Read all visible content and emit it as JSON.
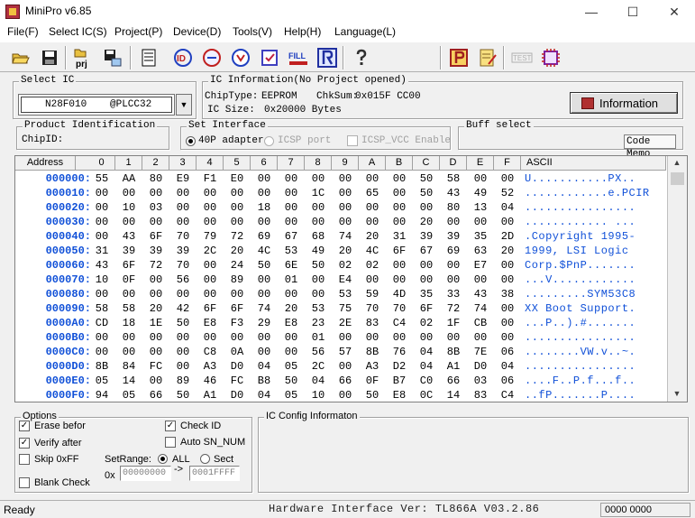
{
  "window": {
    "title": "MiniPro v6.85",
    "minimize": "—",
    "maximize": "☐",
    "close": "✕"
  },
  "menu": [
    "File(F)",
    "Select IC(S)",
    "Project(P)",
    "Device(D)",
    "Tools(V)",
    "Help(H)",
    "Language(L)"
  ],
  "toolbar": {
    "prj_label": "prj",
    "id_label": "ID",
    "fill_label": "FILL",
    "test_label": "TEST"
  },
  "select_ic": {
    "title": "Select IC",
    "name": "N28F010",
    "package": "@PLCC32"
  },
  "ic_info": {
    "title": "IC Information(No Project opened)",
    "chiptype_label": "ChipType:",
    "chiptype": "EEPROM",
    "chksum_label": "ChkSum:",
    "chksum": "0x015F CC00",
    "icsize_label": "IC Size:",
    "icsize": "0x20000 Bytes",
    "button": "Information"
  },
  "product": {
    "title": "Product Identification",
    "chipid_label": "ChipID:"
  },
  "interface": {
    "title": "Set Interface",
    "opt1": "40P adapter",
    "opt2": "ICSP port",
    "opt3": "ICSP_VCC Enable"
  },
  "buff": {
    "title": "Buff select",
    "code_memo": "Code Memo"
  },
  "hex": {
    "headers": [
      "Address",
      "0",
      "1",
      "2",
      "3",
      "4",
      "5",
      "6",
      "7",
      "8",
      "9",
      "A",
      "B",
      "C",
      "D",
      "E",
      "F",
      "ASCII"
    ],
    "rows": [
      {
        "addr": "000000:",
        "bytes": [
          "55",
          "AA",
          "80",
          "E9",
          "F1",
          "E0",
          "00",
          "00",
          "00",
          "00",
          "00",
          "00",
          "50",
          "58",
          "00",
          "00"
        ],
        "ascii": "U...........PX.."
      },
      {
        "addr": "000010:",
        "bytes": [
          "00",
          "00",
          "00",
          "00",
          "00",
          "00",
          "00",
          "00",
          "1C",
          "00",
          "65",
          "00",
          "50",
          "43",
          "49",
          "52"
        ],
        "ascii": "............e.PCIR"
      },
      {
        "addr": "000020:",
        "bytes": [
          "00",
          "10",
          "03",
          "00",
          "00",
          "00",
          "18",
          "00",
          "00",
          "00",
          "00",
          "00",
          "00",
          "80",
          "13",
          "04"
        ],
        "ascii": "................"
      },
      {
        "addr": "000030:",
        "bytes": [
          "00",
          "00",
          "00",
          "00",
          "00",
          "00",
          "00",
          "00",
          "00",
          "00",
          "00",
          "00",
          "20",
          "00",
          "00",
          "00"
        ],
        "ascii": "............ ..."
      },
      {
        "addr": "000040:",
        "bytes": [
          "00",
          "43",
          "6F",
          "70",
          "79",
          "72",
          "69",
          "67",
          "68",
          "74",
          "20",
          "31",
          "39",
          "39",
          "35",
          "2D"
        ],
        "ascii": ".Copyright 1995-"
      },
      {
        "addr": "000050:",
        "bytes": [
          "31",
          "39",
          "39",
          "39",
          "2C",
          "20",
          "4C",
          "53",
          "49",
          "20",
          "4C",
          "6F",
          "67",
          "69",
          "63",
          "20"
        ],
        "ascii": "1999, LSI Logic "
      },
      {
        "addr": "000060:",
        "bytes": [
          "43",
          "6F",
          "72",
          "70",
          "00",
          "24",
          "50",
          "6E",
          "50",
          "02",
          "02",
          "00",
          "00",
          "00",
          "E7",
          "00"
        ],
        "ascii": "Corp.$PnP......."
      },
      {
        "addr": "000070:",
        "bytes": [
          "10",
          "0F",
          "00",
          "56",
          "00",
          "89",
          "00",
          "01",
          "00",
          "E4",
          "00",
          "00",
          "00",
          "00",
          "00",
          "00"
        ],
        "ascii": "...V............"
      },
      {
        "addr": "000080:",
        "bytes": [
          "00",
          "00",
          "00",
          "00",
          "00",
          "00",
          "00",
          "00",
          "00",
          "53",
          "59",
          "4D",
          "35",
          "33",
          "43",
          "38"
        ],
        "ascii": ".........SYM53C8"
      },
      {
        "addr": "000090:",
        "bytes": [
          "58",
          "58",
          "20",
          "42",
          "6F",
          "6F",
          "74",
          "20",
          "53",
          "75",
          "70",
          "70",
          "6F",
          "72",
          "74",
          "00"
        ],
        "ascii": "XX Boot Support."
      },
      {
        "addr": "0000A0:",
        "bytes": [
          "CD",
          "18",
          "1E",
          "50",
          "E8",
          "F3",
          "29",
          "E8",
          "23",
          "2E",
          "83",
          "C4",
          "02",
          "1F",
          "CB",
          "00"
        ],
        "ascii": "...P..).#......."
      },
      {
        "addr": "0000B0:",
        "bytes": [
          "00",
          "00",
          "00",
          "00",
          "00",
          "00",
          "00",
          "00",
          "01",
          "00",
          "00",
          "00",
          "00",
          "00",
          "00",
          "00"
        ],
        "ascii": "................"
      },
      {
        "addr": "0000C0:",
        "bytes": [
          "00",
          "00",
          "00",
          "00",
          "C8",
          "0A",
          "00",
          "00",
          "56",
          "57",
          "8B",
          "76",
          "04",
          "8B",
          "7E",
          "06"
        ],
        "ascii": "........VW.v..~."
      },
      {
        "addr": "0000D0:",
        "bytes": [
          "8B",
          "84",
          "FC",
          "00",
          "A3",
          "D0",
          "04",
          "05",
          "2C",
          "00",
          "A3",
          "D2",
          "04",
          "A1",
          "D0",
          "04"
        ],
        "ascii": "................"
      },
      {
        "addr": "0000E0:",
        "bytes": [
          "05",
          "14",
          "00",
          "89",
          "46",
          "FC",
          "B8",
          "50",
          "04",
          "66",
          "0F",
          "B7",
          "C0",
          "66",
          "03",
          "06"
        ],
        "ascii": "....F..P.f...f.."
      },
      {
        "addr": "0000F0:",
        "bytes": [
          "94",
          "05",
          "66",
          "50",
          "A1",
          "D0",
          "04",
          "05",
          "10",
          "00",
          "50",
          "E8",
          "0C",
          "14",
          "83",
          "C4"
        ],
        "ascii": "..fP.......P...."
      }
    ]
  },
  "options": {
    "title": "Options",
    "erase": "Erase befor",
    "verify": "Verify after",
    "skip": "Skip 0xFF",
    "blank": "Blank Check",
    "checkid": "Check ID",
    "autosn": "Auto SN_NUM",
    "setrange": "SetRange:",
    "all": "ALL",
    "sect": "Sect",
    "ox": "0x",
    "from": "00000000",
    "arrow": "->",
    "to": "0001FFFF"
  },
  "ic_config": {
    "title": "IC Config Informaton"
  },
  "status": {
    "left": "Ready",
    "mid": "Hardware Interface Ver: TL866A V03.2.86",
    "right": "0000 0000"
  }
}
